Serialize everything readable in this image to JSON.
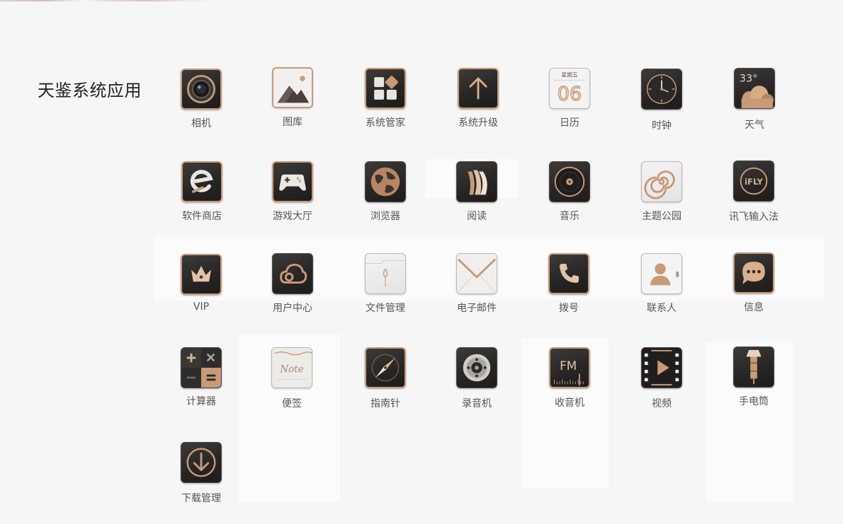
{
  "section": {
    "title": "天鉴系统应用"
  },
  "apps": [
    {
      "label": "相机",
      "icon": "camera-icon"
    },
    {
      "label": "图库",
      "icon": "gallery-icon"
    },
    {
      "label": "系统管家",
      "icon": "system-manager-icon"
    },
    {
      "label": "系统升级",
      "icon": "system-update-icon"
    },
    {
      "label": "日历",
      "icon": "calendar-icon",
      "weekday": "星期五",
      "day": "06"
    },
    {
      "label": "时钟",
      "icon": "clock-icon"
    },
    {
      "label": "天气",
      "icon": "weather-icon",
      "temperature": "33°"
    },
    {
      "label": "软件商店",
      "icon": "app-store-icon"
    },
    {
      "label": "游戏大厅",
      "icon": "game-center-icon"
    },
    {
      "label": "浏览器",
      "icon": "browser-icon"
    },
    {
      "label": "阅读",
      "icon": "reader-icon"
    },
    {
      "label": "音乐",
      "icon": "music-icon"
    },
    {
      "label": "主题公园",
      "icon": "theme-park-icon"
    },
    {
      "label": "讯飞输入法",
      "icon": "ifly-input-icon",
      "logo_text": "iFLY"
    },
    {
      "label": "VIP",
      "icon": "vip-crown-icon"
    },
    {
      "label": "用户中心",
      "icon": "user-center-icon"
    },
    {
      "label": "文件管理",
      "icon": "file-manager-icon"
    },
    {
      "label": "电子邮件",
      "icon": "email-icon"
    },
    {
      "label": "拨号",
      "icon": "phone-dial-icon"
    },
    {
      "label": "联系人",
      "icon": "contacts-icon"
    },
    {
      "label": "信息",
      "icon": "messages-icon"
    },
    {
      "label": "计算器",
      "icon": "calculator-icon"
    },
    {
      "label": "便签",
      "icon": "notes-icon",
      "logo_text": "Note"
    },
    {
      "label": "指南针",
      "icon": "compass-icon"
    },
    {
      "label": "录音机",
      "icon": "recorder-icon"
    },
    {
      "label": "收音机",
      "icon": "radio-icon",
      "logo_text": "FM"
    },
    {
      "label": "视频",
      "icon": "video-icon"
    },
    {
      "label": "手电筒",
      "icon": "flashlight-icon"
    },
    {
      "label": "下载管理",
      "icon": "download-manager-icon"
    }
  ],
  "colors": {
    "gold": "#c89a76",
    "dark": "#262524",
    "background": "#f6f6f6"
  }
}
